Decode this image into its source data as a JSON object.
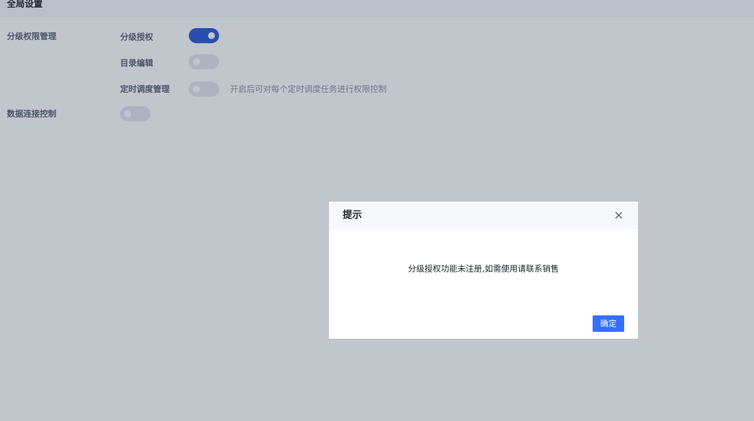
{
  "header": {
    "title": "全局设置"
  },
  "settings": {
    "graded_permission": {
      "label": "分级权限管理",
      "items": [
        {
          "label": "分级授权",
          "enabled": true
        },
        {
          "label": "目录编辑",
          "enabled": false
        },
        {
          "label": "定时调度管理",
          "enabled": false,
          "hint": "开启后可对每个定时调度任务进行权限控制"
        }
      ]
    },
    "data_connection": {
      "label": "数据连接控制",
      "enabled": false
    }
  },
  "dialog": {
    "title": "提示",
    "message": "分级授权功能未注册,如需使用请联系销售",
    "ok_label": "确定",
    "close_icon": "close-icon"
  },
  "colors": {
    "accent": "#3370ff",
    "toggle_on": "#2f5bd8",
    "toggle_off": "#e4e7ed"
  }
}
